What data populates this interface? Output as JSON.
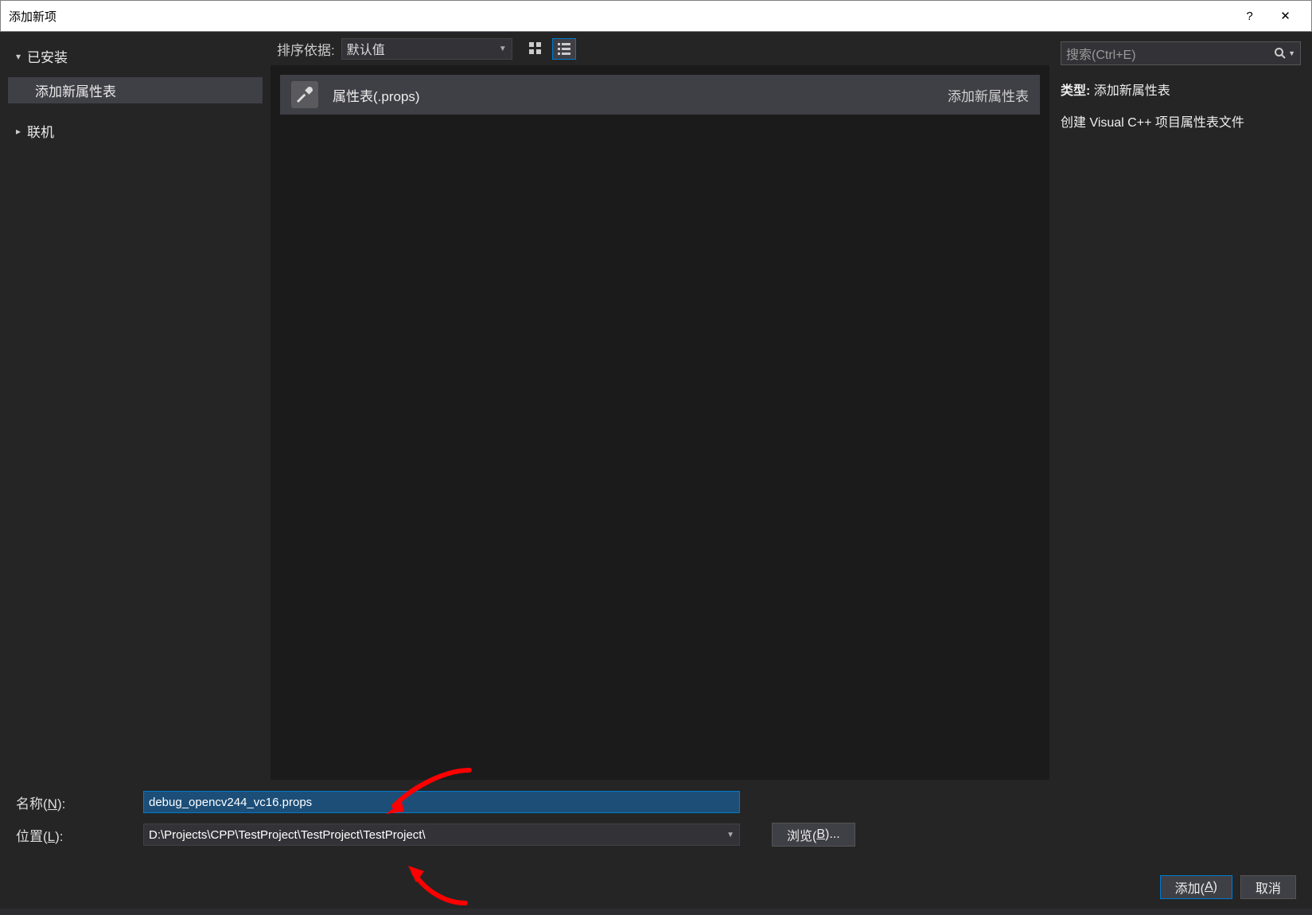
{
  "window": {
    "title": "添加新项",
    "help": "?",
    "close": "✕"
  },
  "sidebar": {
    "installed": "已安装",
    "item_selected": "添加新属性表",
    "online": "联机"
  },
  "toolbar": {
    "sort_label": "排序依据:",
    "sort_value": "默认值"
  },
  "search": {
    "placeholder": "搜索(Ctrl+E)"
  },
  "list": {
    "items": [
      {
        "name": "属性表(.props)",
        "category": "添加新属性表"
      }
    ]
  },
  "details": {
    "type_label": "类型:",
    "type_value": "添加新属性表",
    "desc": "创建 Visual C++ 项目属性表文件"
  },
  "form": {
    "name_label_pre": "名称(",
    "name_label_u": "N",
    "name_label_post": "):",
    "name_value": "debug_opencv244_vc16.props",
    "loc_label_pre": "位置(",
    "loc_label_u": "L",
    "loc_label_post": "):",
    "loc_value": "D:\\Projects\\CPP\\TestProject\\TestProject\\TestProject\\",
    "browse_pre": "浏览(",
    "browse_u": "B",
    "browse_post": ")...",
    "add_pre": "添加(",
    "add_u": "A",
    "add_post": ")",
    "cancel": "取消"
  }
}
